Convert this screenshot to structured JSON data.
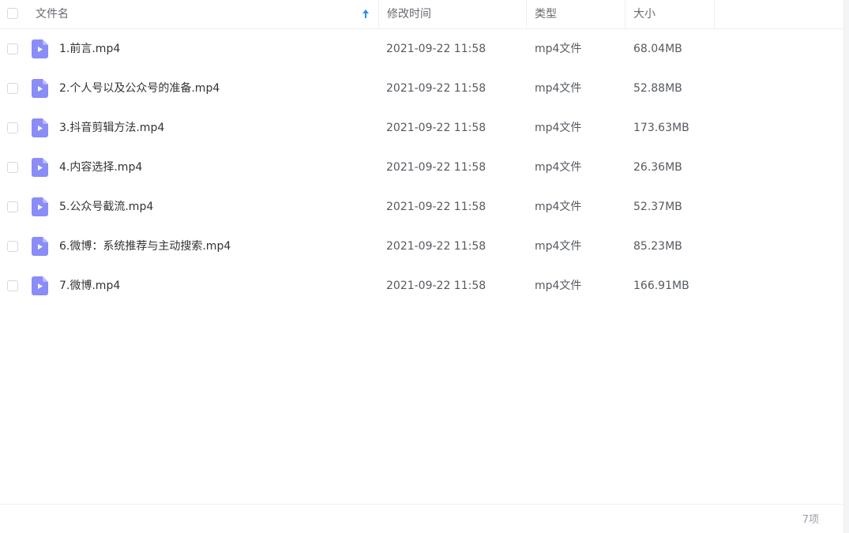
{
  "header": {
    "col_name": "文件名",
    "col_time": "修改时间",
    "col_type": "类型",
    "col_size": "大小",
    "sort_icon": "arrow-up-icon"
  },
  "files": [
    {
      "name": "1.前言.mp4",
      "time": "2021-09-22 11:58",
      "type": "mp4文件",
      "size": "68.04MB"
    },
    {
      "name": "2.个人号以及公众号的准备.mp4",
      "time": "2021-09-22 11:58",
      "type": "mp4文件",
      "size": "52.88MB"
    },
    {
      "name": "3.抖音剪辑方法.mp4",
      "time": "2021-09-22 11:58",
      "type": "mp4文件",
      "size": "173.63MB"
    },
    {
      "name": "4.内容选择.mp4",
      "time": "2021-09-22 11:58",
      "type": "mp4文件",
      "size": "26.36MB"
    },
    {
      "name": "5.公众号截流.mp4",
      "time": "2021-09-22 11:58",
      "type": "mp4文件",
      "size": "52.37MB"
    },
    {
      "name": "6.微博：系统推荐与主动搜索.mp4",
      "time": "2021-09-22 11:58",
      "type": "mp4文件",
      "size": "85.23MB"
    },
    {
      "name": "7.微博.mp4",
      "time": "2021-09-22 11:58",
      "type": "mp4文件",
      "size": "166.91MB"
    }
  ],
  "footer": {
    "count_label": "7项"
  },
  "colors": {
    "accent": "#2b8ef3",
    "video_icon": "#8a8cf7"
  }
}
